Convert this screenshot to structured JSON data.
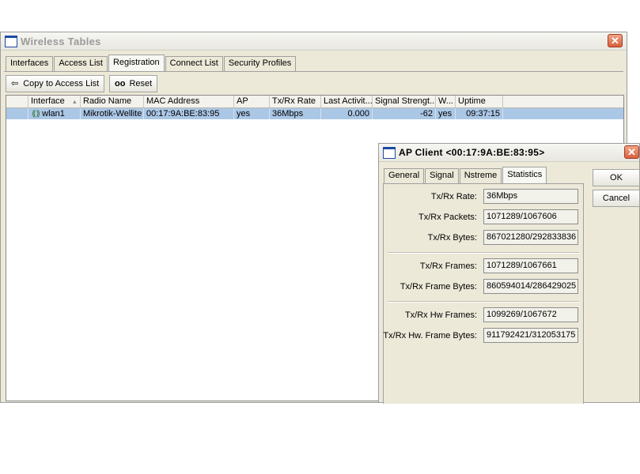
{
  "main_window": {
    "title": "Wireless Tables",
    "close_glyph": "✕",
    "tabs": [
      {
        "label": "Interfaces"
      },
      {
        "label": "Access List"
      },
      {
        "label": "Registration"
      },
      {
        "label": "Connect List"
      },
      {
        "label": "Security Profiles"
      }
    ],
    "toolbar": {
      "copy_label": "Copy to Access List",
      "copy_icon": "⇦",
      "reset_label": "Reset",
      "reset_icon": "oo"
    },
    "table": {
      "columns": [
        {
          "label": "Interface",
          "sort": "▲"
        },
        {
          "label": "Radio Name"
        },
        {
          "label": "MAC Address"
        },
        {
          "label": "AP"
        },
        {
          "label": "Tx/Rx Rate"
        },
        {
          "label": "Last Activit..."
        },
        {
          "label": "Signal Strengt..."
        },
        {
          "label": "W..."
        },
        {
          "label": "Uptime"
        }
      ],
      "rows": [
        {
          "interface": "wlan1",
          "radio_name": "Mikrotik-Wellite",
          "mac": "00:17:9A:BE:83:95",
          "ap": "yes",
          "rate": "36Mbps",
          "last_activity": "0.000",
          "signal": "-62",
          "w": "yes",
          "uptime": "09:37:15"
        }
      ]
    }
  },
  "dialog": {
    "title": "AP Client <00:17:9A:BE:83:95>",
    "close_glyph": "✕",
    "tabs": [
      {
        "label": "General"
      },
      {
        "label": "Signal"
      },
      {
        "label": "Nstreme"
      },
      {
        "label": "Statistics"
      }
    ],
    "buttons": {
      "ok": "OK",
      "cancel": "Cancel"
    },
    "fields": [
      {
        "label": "Tx/Rx Rate:",
        "value": "36Mbps"
      },
      {
        "label": "Tx/Rx Packets:",
        "value": "1071289/1067606"
      },
      {
        "label": "Tx/Rx Bytes:",
        "value": "867021280/292833836"
      },
      {
        "label": "Tx/Rx Frames:",
        "value": "1071289/1067661"
      },
      {
        "label": "Tx/Rx Frame Bytes:",
        "value": "860594014/286429025"
      },
      {
        "label": "Tx/Rx Hw Frames:",
        "value": "1099269/1067672"
      },
      {
        "label": "Tx/Rx Hw. Frame Bytes:",
        "value": "911792421/312053175"
      }
    ]
  },
  "colors": {
    "selection": "#abc7e6",
    "window_bg": "#ece9d8",
    "close_button": "#d9603f"
  }
}
